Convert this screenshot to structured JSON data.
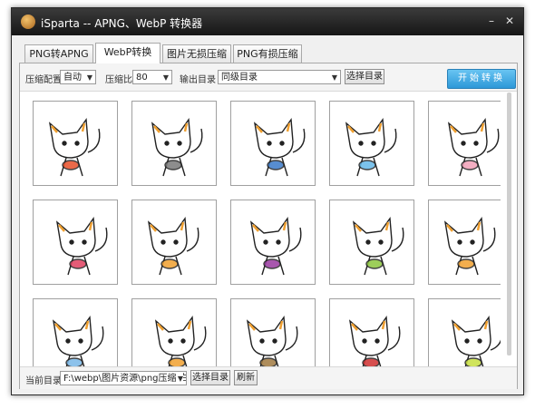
{
  "app": {
    "title": "iSparta -- APNG、WebP 转换器"
  },
  "tabs": [
    {
      "label": "PNG转APNG"
    },
    {
      "label": "WebP转换"
    },
    {
      "label": "图片无损压缩"
    },
    {
      "label": "PNG有损压缩"
    }
  ],
  "toolbar": {
    "compress_config_label": "压缩配置",
    "compress_config_value": "自动",
    "compress_ratio_label": "压缩比",
    "compress_ratio_value": "80",
    "output_dir_label": "输出目录",
    "output_dir_value": "同级目录",
    "select_dir_button": "选择目录",
    "start_button": "开始转换"
  },
  "bottom": {
    "current_dir_label": "当前目录",
    "current_dir_value": "F:\\webp\\图片资源\\png压缩\\白",
    "select_dir_button": "选择目录",
    "refresh_button": "刷新"
  },
  "thumbnails": [
    {
      "accent": "#e8502a"
    },
    {
      "accent": "#7a7a7a"
    },
    {
      "accent": "#3a7ac8"
    },
    {
      "accent": "#64b8e8"
    },
    {
      "accent": "#f2a0b8"
    },
    {
      "accent": "#e04060"
    },
    {
      "accent": "#f0a030"
    },
    {
      "accent": "#9a3aa0"
    },
    {
      "accent": "#8cc63e"
    },
    {
      "accent": "#f0a030"
    },
    {
      "accent": "#7ab8e8"
    },
    {
      "accent": "#f0a030"
    },
    {
      "accent": "#a07a40"
    },
    {
      "accent": "#d03030"
    },
    {
      "accent": "#c8e040"
    }
  ]
}
